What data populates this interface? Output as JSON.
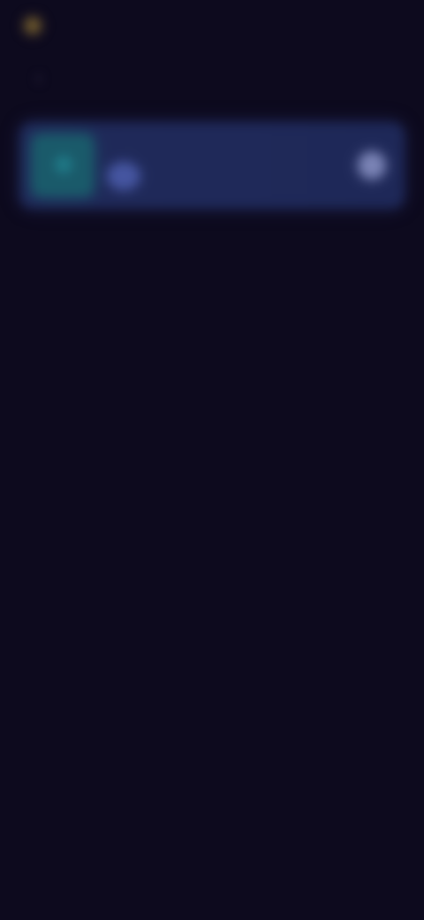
{
  "header": {
    "logo_text": "",
    "title": ""
  },
  "card": {
    "title": "",
    "subtitle": ""
  },
  "colors": {
    "background": "#0d0a1e",
    "card": "#202a5a",
    "icon_tile": "#1a5a6a",
    "logo": "#6f5a2d"
  },
  "icons": {
    "logo": "app-logo-icon",
    "back": "back-arrow-icon",
    "card_tile": "tile-icon",
    "avatar": "avatar-icon",
    "action": "action-icon"
  }
}
